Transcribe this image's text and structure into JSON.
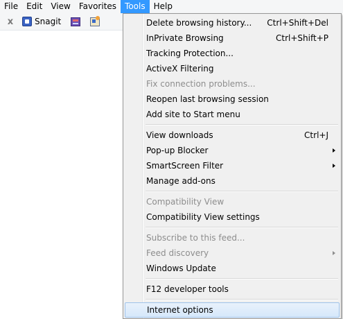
{
  "menubar": {
    "items": [
      {
        "label": "File"
      },
      {
        "label": "Edit"
      },
      {
        "label": "View"
      },
      {
        "label": "Favorites"
      },
      {
        "label": "Tools",
        "active": true
      },
      {
        "label": "Help"
      }
    ]
  },
  "toolbar": {
    "close_glyph": "x",
    "snagit_label": "Snagit",
    "icons": [
      "close-icon",
      "snagit-icon",
      "capture-window-icon",
      "edit-image-icon"
    ]
  },
  "tools_menu": {
    "items": [
      {
        "label": "Delete browsing history...",
        "shortcut": "Ctrl+Shift+Del"
      },
      {
        "label": "InPrivate Browsing",
        "shortcut": "Ctrl+Shift+P"
      },
      {
        "label": "Tracking Protection..."
      },
      {
        "label": "ActiveX Filtering"
      },
      {
        "label": "Fix connection problems...",
        "disabled": true
      },
      {
        "label": "Reopen last browsing session"
      },
      {
        "label": "Add site to Start menu"
      },
      {
        "label": "View downloads",
        "shortcut": "Ctrl+J"
      },
      {
        "label": "Pop-up Blocker",
        "submenu": true
      },
      {
        "label": "SmartScreen Filter",
        "submenu": true
      },
      {
        "label": "Manage add-ons"
      },
      {
        "label": "Compatibility View",
        "disabled": true
      },
      {
        "label": "Compatibility View settings"
      },
      {
        "label": "Subscribe to this feed...",
        "disabled": true
      },
      {
        "label": "Feed discovery",
        "disabled": true,
        "submenu": true
      },
      {
        "label": "Windows Update"
      },
      {
        "label": "F12 developer tools"
      },
      {
        "label": "Internet options",
        "highlighted": true
      }
    ]
  },
  "colors": {
    "menubar_active_bg": "#3399ff",
    "menu_bg": "#f0f0f0",
    "disabled_text": "#8d8d8d",
    "highlight_border": "#9ec2ea"
  }
}
